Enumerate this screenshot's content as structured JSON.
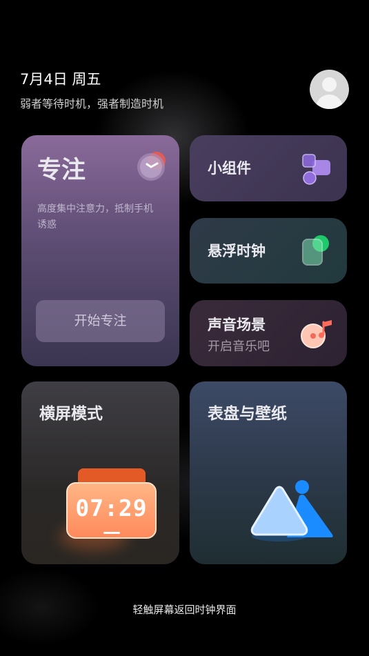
{
  "header": {
    "date": "7月4日 周五",
    "motto": "弱者等待时机，强者制造时机"
  },
  "cards": {
    "focus": {
      "title": "专注",
      "description": "高度集中注意力，抵制手机诱惑",
      "button_label": "开始专注",
      "icon": "alarm-clock-icon"
    },
    "widget": {
      "title": "小组件",
      "icon": "widgets-icon"
    },
    "floating_clock": {
      "title": "悬浮时钟",
      "icon": "floating-window-icon"
    },
    "sound_scene": {
      "title": "声音场景",
      "subtitle": "开启音乐吧",
      "icon": "music-disc-icon"
    },
    "landscape_mode": {
      "title": "横屏模式",
      "clock_time": "07:29",
      "icon": "landscape-clock-icon"
    },
    "dial_wallpaper": {
      "title": "表盘与壁纸",
      "icon": "image-mountain-icon"
    }
  },
  "footer": {
    "hint": "轻触屏幕返回时钟界面"
  },
  "colors": {
    "accent_orange": "#ff8a5c",
    "accent_blue": "#1a8cff",
    "accent_green": "#1fc86a",
    "accent_purple": "#a07cf0"
  }
}
